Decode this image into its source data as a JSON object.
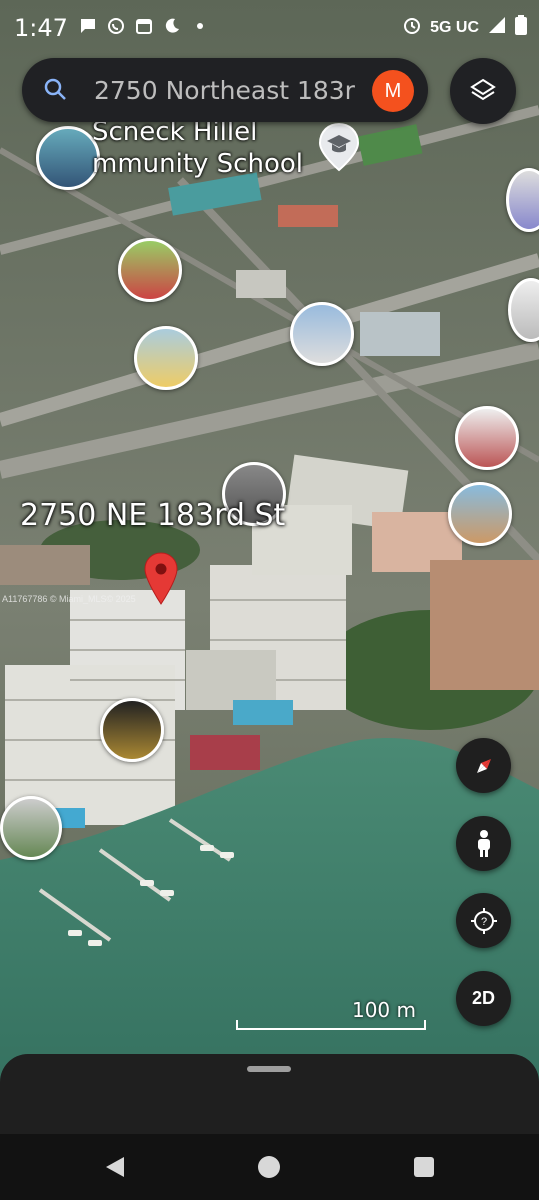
{
  "status_bar": {
    "time": "1:47",
    "network": "5G UC"
  },
  "search": {
    "query": "2750 Northeast 183r",
    "avatar_letter": "M"
  },
  "map": {
    "school_label_line1": "Scneck Hillel",
    "school_label_line2": "mmunity School",
    "address_label": "2750 NE 183rd St",
    "watermark": "A11767786 © Miami_MLS© 2025",
    "scale_label": "100 m"
  },
  "controls": {
    "two_d_label": "2D"
  },
  "colors": {
    "water": "#3f7f6c",
    "land": "#6f7a6a",
    "pin": "#e53935",
    "avatar": "#f4511e"
  }
}
